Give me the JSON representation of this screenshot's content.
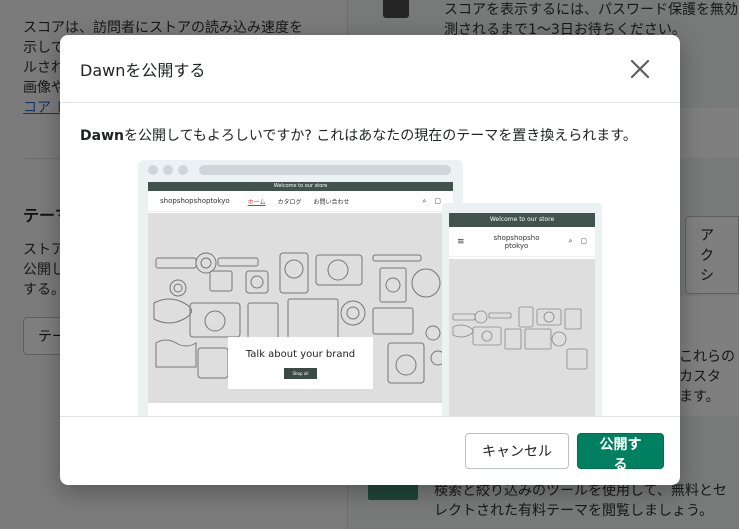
{
  "background": {
    "left_texts": [
      "スコアは、訪問者にストアの読み込み速度を",
      "示して",
      "ルされ",
      "画像や"
    ],
    "left_link": "コア レ",
    "theme_heading": "テーマ",
    "theme_desc": [
      "ストア",
      "公開し",
      "する。"
    ],
    "theme_button": "テー",
    "right_texts": [
      "スコアを表示するには、パスワード保護を無効",
      "測されるまで1〜3日お待ちください。"
    ],
    "action_button": "アクシ",
    "right_mid_texts": [
      "これらの",
      "カスタ",
      "ます。"
    ],
    "right_bottom_texts": [
      "検索と絞り込みのツールを使用して、無料とセ",
      "レクトされた有料テーマを閲覧しましょう。"
    ]
  },
  "modal": {
    "title": "Dawnを公開する",
    "message_theme": "Dawn",
    "message_rest": "を公開してもよろしいですか? これはあなたの現在のテーマを置き換えられます。",
    "cancel_label": "キャンセル",
    "publish_label": "公開する"
  },
  "preview": {
    "announcement": "Welcome to our store",
    "store_name": "shopshopshoptokyo",
    "mobile_store_name_line1": "shopshopsho",
    "mobile_store_name_line2": "ptokyo",
    "nav_links": [
      "ホーム",
      "カタログ",
      "お問い合わせ"
    ],
    "hero_heading": "Talk about your brand",
    "hero_button": "Shop all"
  },
  "colors": {
    "primary": "#008060",
    "announcement_bar": "#42534d",
    "overlay": "rgba(0,0,0,0.5)"
  },
  "icons": {
    "close": "close-icon",
    "search": "search-icon",
    "cart": "cart-icon",
    "menu": "hamburger-icon",
    "lock": "lock-icon"
  }
}
